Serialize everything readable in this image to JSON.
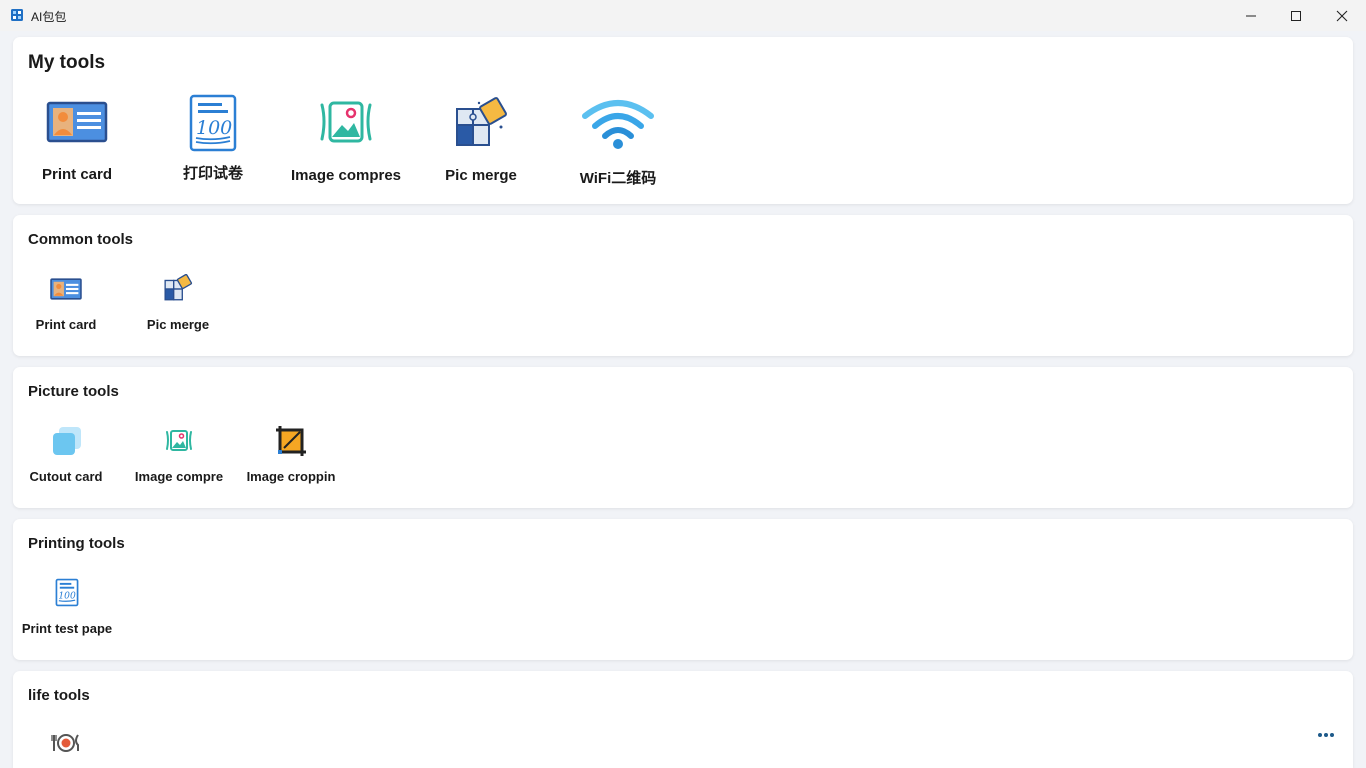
{
  "window": {
    "title": "AI包包"
  },
  "sections": {
    "my_tools": {
      "title": "My tools",
      "items": [
        {
          "label": "Print card",
          "icon": "id-card-icon"
        },
        {
          "label": "打印试卷",
          "icon": "test-paper-icon"
        },
        {
          "label": "Image compres",
          "icon": "image-compress-icon"
        },
        {
          "label": "Pic merge",
          "icon": "puzzle-merge-icon"
        },
        {
          "label": "WiFi二维码",
          "icon": "wifi-icon"
        }
      ]
    },
    "common_tools": {
      "title": "Common tools",
      "items": [
        {
          "label": "Print card",
          "icon": "id-card-icon"
        },
        {
          "label": "Pic merge",
          "icon": "puzzle-merge-icon"
        }
      ]
    },
    "picture_tools": {
      "title": "Picture tools",
      "items": [
        {
          "label": "Cutout card",
          "icon": "cutout-card-icon"
        },
        {
          "label": "Image compre",
          "icon": "image-compress-icon"
        },
        {
          "label": "Image croppin",
          "icon": "crop-icon"
        }
      ]
    },
    "printing_tools": {
      "title": "Printing tools",
      "items": [
        {
          "label": "Print test pape",
          "icon": "test-paper-icon"
        }
      ]
    },
    "life_tools": {
      "title": "life tools",
      "items": [
        {
          "label": "",
          "icon": "dining-icon"
        }
      ]
    }
  },
  "colors": {
    "accent": "#2b7fd4",
    "more_dots": "#1d5a8a",
    "card_bg": "#ffffff",
    "page_bg": "#f1f3f7"
  }
}
